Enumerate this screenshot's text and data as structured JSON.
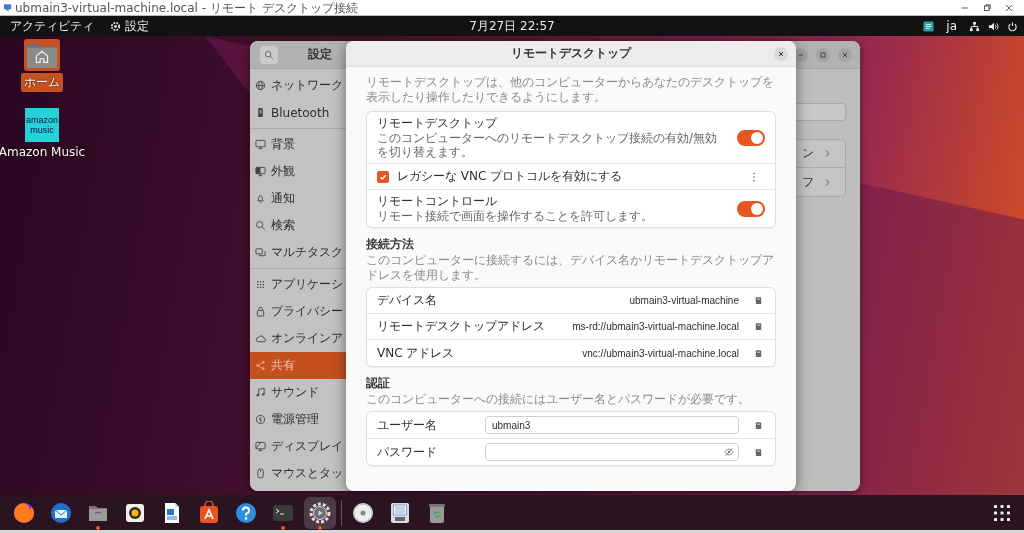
{
  "remote_window": {
    "title": "ubmain3-virtual-machine.local - リモート デスクトップ接続"
  },
  "top_bar": {
    "activities": "アクティビティ",
    "app_menu": "設定",
    "clock": "7月27日  22:57",
    "input_method": "ja"
  },
  "desktop_icons": [
    {
      "kind": "home",
      "label": "ホーム",
      "selected": true
    },
    {
      "kind": "music",
      "label": "Amazon Music",
      "icon_text": "amazon music",
      "selected": false
    }
  ],
  "settings": {
    "title": "設定",
    "sidebar": [
      {
        "kind": "network",
        "label": "ネットワーク",
        "selected": false
      },
      {
        "kind": "bluetooth",
        "label": "Bluetooth",
        "selected": false
      },
      {
        "kind": "background",
        "label": "背景",
        "selected": false
      },
      {
        "kind": "appearance",
        "label": "外観",
        "selected": false
      },
      {
        "kind": "notifications",
        "label": "通知",
        "selected": false
      },
      {
        "kind": "search",
        "label": "検索",
        "selected": false
      },
      {
        "kind": "multitask",
        "label": "マルチタスク",
        "selected": false
      },
      {
        "kind": "apps",
        "label": "アプリケーシ",
        "selected": false
      },
      {
        "kind": "privacy",
        "label": "プライバシー",
        "selected": false
      },
      {
        "kind": "online",
        "label": "オンラインア",
        "selected": false
      },
      {
        "kind": "sharing",
        "label": "共有",
        "selected": true
      },
      {
        "kind": "sound",
        "label": "サウンド",
        "selected": false
      },
      {
        "kind": "power",
        "label": "電源管理",
        "selected": false
      },
      {
        "kind": "display",
        "label": "ディスプレイ",
        "selected": false
      },
      {
        "kind": "mouse",
        "label": "マウスとタッ",
        "selected": false
      }
    ],
    "behind_rows": [
      {
        "text": "ン"
      },
      {
        "text": "フ"
      }
    ]
  },
  "dialog": {
    "title": "リモートデスクトップ",
    "intro": "リモートデスクトップは、他のコンピューターからあなたのデスクトップを表示したり操作したりできるようにします。",
    "options": [
      {
        "kind": "switch",
        "title": "リモートデスクトップ",
        "subtitle": "このコンピューターへのリモートデスクトップ接続の有効/無効を切り替えます。",
        "on": true
      },
      {
        "kind": "checkbox",
        "title": "レガシーな VNC プロトコルを有効にする",
        "checked": true
      },
      {
        "kind": "switch",
        "title": "リモートコントロール",
        "subtitle": "リモート接続で画面を操作することを許可します。",
        "on": true
      }
    ],
    "connection": {
      "heading": "接続方法",
      "description": "このコンピューターに接続するには、デバイス名かリモートデスクトップアドレスを使用します。",
      "rows": [
        {
          "label": "デバイス名",
          "value": "ubmain3-virtual-machine"
        },
        {
          "label": "リモートデスクトップアドレス",
          "value": "ms-rd://ubmain3-virtual-machine.local"
        },
        {
          "label": "VNC アドレス",
          "value": "vnc://ubmain3-virtual-machine.local"
        }
      ]
    },
    "auth": {
      "heading": "認証",
      "description": "このコンピューターへの接続にはユーザー名とパスワードが必要です。",
      "fields": [
        {
          "kind": "text",
          "label": "ユーザー名",
          "value": "ubmain3"
        },
        {
          "kind": "password",
          "label": "パスワード"
        }
      ]
    }
  },
  "dock": {
    "items": [
      {
        "kind": "browser",
        "running": false,
        "selected": false
      },
      {
        "kind": "mail",
        "running": false,
        "selected": false
      },
      {
        "kind": "files",
        "running": true,
        "selected": false
      },
      {
        "kind": "speaker",
        "running": false,
        "selected": false
      },
      {
        "kind": "document",
        "running": false,
        "selected": false
      },
      {
        "kind": "store",
        "running": false,
        "selected": false
      },
      {
        "kind": "help",
        "running": false,
        "selected": false
      },
      {
        "kind": "terminal",
        "running": true,
        "selected": false
      },
      {
        "kind": "settings",
        "running": true,
        "selected": true
      },
      {
        "kind": "separator"
      },
      {
        "kind": "disc",
        "running": false,
        "selected": false
      },
      {
        "kind": "drive",
        "running": false,
        "selected": false
      },
      {
        "kind": "trash",
        "running": false,
        "selected": false
      }
    ]
  }
}
